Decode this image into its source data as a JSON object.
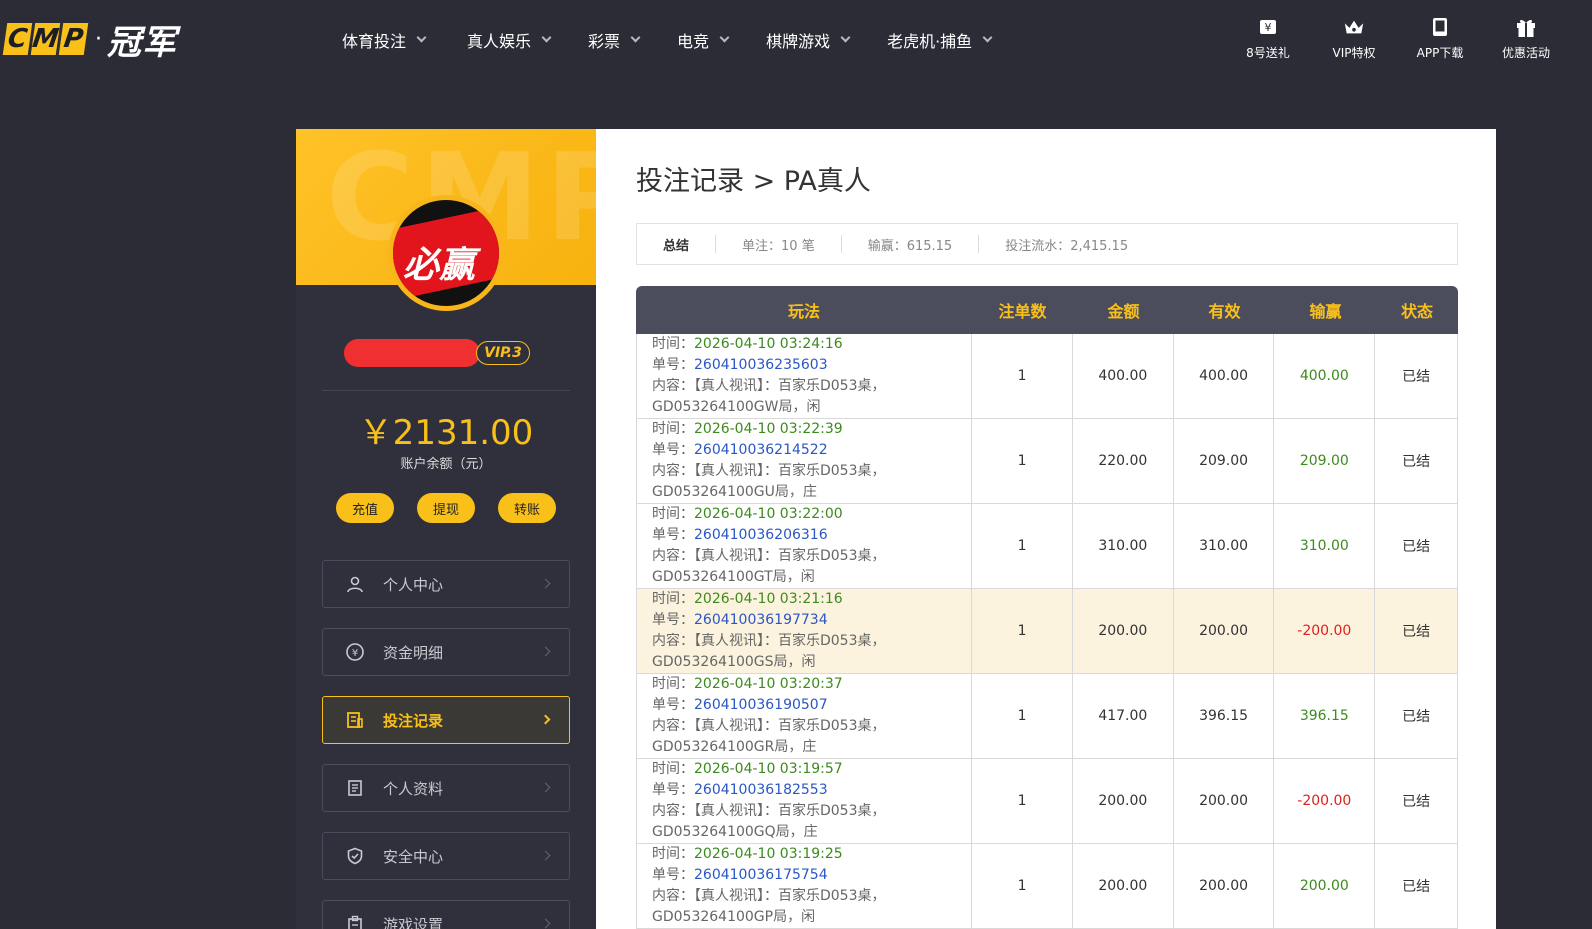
{
  "header": {
    "logo_letters": [
      "C",
      "M",
      "P"
    ],
    "logo_text": "冠军",
    "nav": [
      {
        "label": "体育投注"
      },
      {
        "label": "真人娱乐"
      },
      {
        "label": "彩票"
      },
      {
        "label": "电竞"
      },
      {
        "label": "棋牌游戏"
      },
      {
        "label": "老虎机·捕鱼"
      }
    ],
    "icons": [
      {
        "label": "8号送礼",
        "icon": "gift-card-icon"
      },
      {
        "label": "VIP特权",
        "icon": "crown-icon"
      },
      {
        "label": "APP下载",
        "icon": "phone-icon"
      },
      {
        "label": "优惠活动",
        "icon": "gift-icon"
      }
    ]
  },
  "sidebar": {
    "watermark": "CMP",
    "avatar_text": "必赢",
    "vip": "VIP.3",
    "balance": "￥2131.00",
    "balance_label": "账户余额（元）",
    "buttons": [
      "充值",
      "提现",
      "转账"
    ],
    "menu": [
      {
        "label": "个人中心",
        "icon": "user-icon"
      },
      {
        "label": "资金明细",
        "icon": "money-icon"
      },
      {
        "label": "投注记录",
        "icon": "bet-record-icon",
        "active": true
      },
      {
        "label": "个人资料",
        "icon": "document-icon"
      },
      {
        "label": "安全中心",
        "icon": "shield-icon"
      },
      {
        "label": "游戏设置",
        "icon": "settings-icon"
      }
    ]
  },
  "main": {
    "title": "投注记录 > PA真人",
    "summary": {
      "label": "总结",
      "count": "单注：10 笔",
      "winloss": "输赢：615.15",
      "turnover": "投注流水：2,415.15"
    },
    "columns": [
      "玩法",
      "注单数",
      "金额",
      "有效",
      "输赢",
      "状态"
    ],
    "labels": {
      "time": "时间：",
      "order": "单号：",
      "content": "内容："
    },
    "rows": [
      {
        "time": "2026-04-10 03:24:16",
        "order": "260410036235603",
        "content1": "【真人视讯】：百家乐D053桌，",
        "content2": "GD053264100GW局，闲",
        "count": "1",
        "amount": "400.00",
        "valid": "400.00",
        "winloss": "400.00",
        "status": "已结",
        "negative": false
      },
      {
        "time": "2026-04-10 03:22:39",
        "order": "260410036214522",
        "content1": "【真人视讯】：百家乐D053桌，",
        "content2": "GD053264100GU局，庄",
        "count": "1",
        "amount": "220.00",
        "valid": "209.00",
        "winloss": "209.00",
        "status": "已结",
        "negative": false
      },
      {
        "time": "2026-04-10 03:22:00",
        "order": "260410036206316",
        "content1": "【真人视讯】：百家乐D053桌，",
        "content2": "GD053264100GT局，闲",
        "count": "1",
        "amount": "310.00",
        "valid": "310.00",
        "winloss": "310.00",
        "status": "已结",
        "negative": false
      },
      {
        "time": "2026-04-10 03:21:16",
        "order": "260410036197734",
        "content1": "【真人视讯】：百家乐D053桌，",
        "content2": "GD053264100GS局，闲",
        "count": "1",
        "amount": "200.00",
        "valid": "200.00",
        "winloss": "-200.00",
        "status": "已结",
        "negative": true,
        "highlight": true
      },
      {
        "time": "2026-04-10 03:20:37",
        "order": "260410036190507",
        "content1": "【真人视讯】：百家乐D053桌，",
        "content2": "GD053264100GR局，庄",
        "count": "1",
        "amount": "417.00",
        "valid": "396.15",
        "winloss": "396.15",
        "status": "已结",
        "negative": false
      },
      {
        "time": "2026-04-10 03:19:57",
        "order": "260410036182553",
        "content1": "【真人视讯】：百家乐D053桌，",
        "content2": "GD053264100GQ局，庄",
        "count": "1",
        "amount": "200.00",
        "valid": "200.00",
        "winloss": "-200.00",
        "status": "已结",
        "negative": true
      },
      {
        "time": "2026-04-10 03:19:25",
        "order": "260410036175754",
        "content1": "【真人视讯】：百家乐D053桌，",
        "content2": "GD053264100GP局，闲",
        "count": "1",
        "amount": "200.00",
        "valid": "200.00",
        "winloss": "200.00",
        "status": "已结",
        "negative": false
      }
    ]
  },
  "colors": {
    "accent": "#f9c01a",
    "positive": "#3d8a1e",
    "negative": "#e0201f",
    "order": "#2b56c5"
  }
}
